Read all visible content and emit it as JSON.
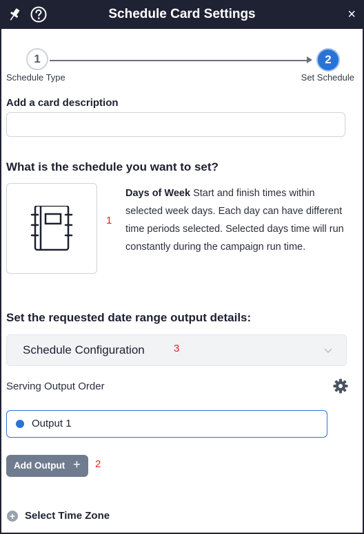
{
  "header": {
    "title": "Schedule Card Settings",
    "pin_icon": "pin-icon",
    "help_icon": "help-circle-icon",
    "close_label": "×"
  },
  "stepper": {
    "steps": [
      {
        "number": "1",
        "label": "Schedule Type",
        "state": "completed"
      },
      {
        "number": "2",
        "label": "Set Schedule",
        "state": "active"
      }
    ]
  },
  "description": {
    "label": "Add a card description",
    "value": "",
    "placeholder": ""
  },
  "schedule_question": "What is the schedule you want to set?",
  "schedule_option": {
    "icon": "notebook-icon",
    "annotation": "1",
    "title": "Days of Week",
    "text": "Start and finish times within selected week days. Each day can have different time periods selected. Selected days time will run constantly during the campaign run time."
  },
  "range_question": "Set the requested date range output details:",
  "config": {
    "label": "Schedule Configuration",
    "annotation": "3",
    "icon": "chevron-down-icon"
  },
  "serving": {
    "label": "Serving Output Order",
    "icon": "gear-icon"
  },
  "outputs": [
    {
      "label": "Output 1"
    }
  ],
  "add_output": {
    "label": "Add Output",
    "plus": "+",
    "annotation": "2"
  },
  "time_zone": {
    "label": "Select Time Zone",
    "icon": "plus-circle-icon",
    "glyph": "+"
  },
  "colors": {
    "header_bg": "#1f2233",
    "accent": "#2a73d6",
    "button_bg": "#6f7c8f",
    "annotation_red": "#e02424"
  }
}
